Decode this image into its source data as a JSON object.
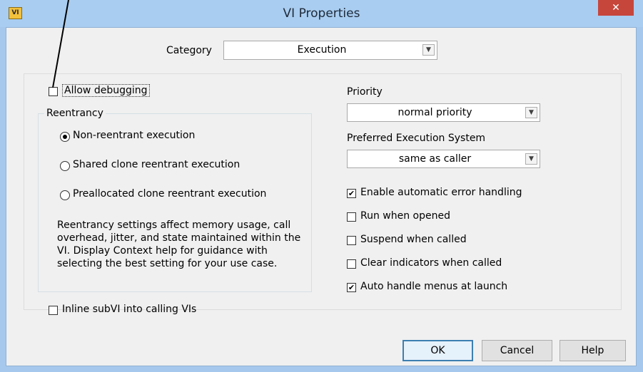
{
  "window": {
    "title": "VI Properties",
    "close_symbol": "✕",
    "app_icon_text": "VI"
  },
  "category": {
    "label": "Category",
    "value": "Execution"
  },
  "allow_debugging": {
    "label": "Allow debugging",
    "checked": false
  },
  "reentrancy": {
    "title": "Reentrancy",
    "options": [
      {
        "label": "Non-reentrant execution",
        "selected": true
      },
      {
        "label": "Shared clone reentrant execution",
        "selected": false
      },
      {
        "label": "Preallocated clone reentrant execution",
        "selected": false
      }
    ],
    "description": "Reentrancy settings affect memory usage, call overhead, jitter, and state maintained within the VI. Display Context help for guidance with selecting the best setting for your use case."
  },
  "inline_subvi": {
    "label": "Inline subVI into calling VIs",
    "checked": false
  },
  "priority": {
    "label": "Priority",
    "value": "normal priority"
  },
  "execution_system": {
    "label": "Preferred Execution System",
    "value": "same as caller"
  },
  "options": [
    {
      "label": "Enable automatic error handling",
      "checked": true
    },
    {
      "label": "Run when opened",
      "checked": false
    },
    {
      "label": "Suspend when called",
      "checked": false
    },
    {
      "label": "Clear indicators when called",
      "checked": false
    },
    {
      "label": "Auto handle menus at launch",
      "checked": true
    }
  ],
  "buttons": {
    "ok": "OK",
    "cancel": "Cancel",
    "help": "Help"
  },
  "check_mark": "✔",
  "combo_arrow": "▼"
}
